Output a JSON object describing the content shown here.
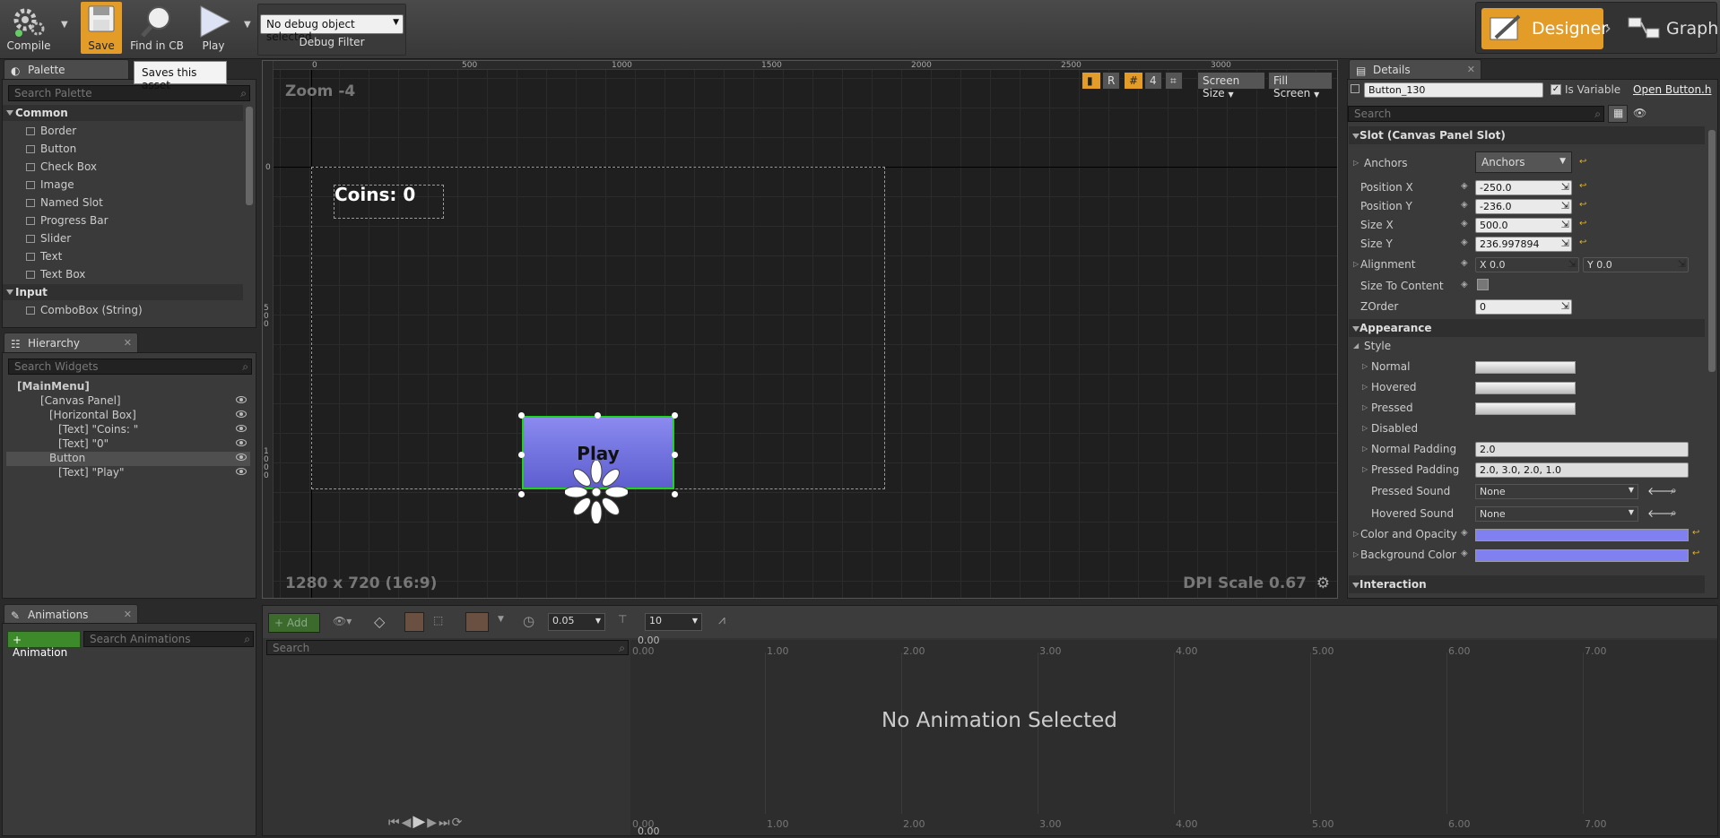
{
  "toolbar": {
    "compile": "Compile",
    "save": "Save",
    "find_in_cb": "Find in CB",
    "play": "Play",
    "debug_select": "No debug object selected",
    "debug_filter": "Debug Filter",
    "tooltip": "Saves this asset"
  },
  "mode": {
    "designer": "Designer",
    "graph": "Graph"
  },
  "palette": {
    "tab": "Palette",
    "search_placeholder": "Search Palette",
    "categories": [
      "Common",
      "Input"
    ],
    "items": [
      "Border",
      "Button",
      "Check Box",
      "Image",
      "Named Slot",
      "Progress Bar",
      "Slider",
      "Text",
      "Text Box"
    ],
    "input_items": [
      "ComboBox (String)"
    ]
  },
  "hierarchy": {
    "tab": "Hierarchy",
    "search_placeholder": "Search Widgets",
    "rows": [
      "[MainMenu]",
      "[Canvas Panel]",
      "[Horizontal Box]",
      "[Text] \"Coins: \"",
      "[Text] \"0\"",
      "Button",
      "[Text] \"Play\""
    ]
  },
  "viewport": {
    "zoom": "Zoom -4",
    "resolution": "1280 x 720 (16:9)",
    "dpi": "DPI Scale 0.67",
    "ruler_x": [
      "0",
      "500",
      "1000",
      "1500",
      "2000",
      "2500",
      "3000"
    ],
    "ruler_y": [
      "0",
      "500",
      "1000"
    ],
    "r_label": "R",
    "grid_snap": "4",
    "screen_size": "Screen Size",
    "fill_screen": "Fill Screen",
    "coins_text": "Coins: 0",
    "button_text": "Play"
  },
  "details": {
    "tab": "Details",
    "name": "Button_130",
    "is_variable": "Is Variable",
    "open": "Open Button.h",
    "search_placeholder": "Search",
    "slot_section": "Slot (Canvas Panel Slot)",
    "anchors_label": "Anchors",
    "anchors_value": "Anchors",
    "pos_x_label": "Position X",
    "pos_x": "-250.0",
    "pos_y_label": "Position Y",
    "pos_y": "-236.0",
    "size_x_label": "Size X",
    "size_x": "500.0",
    "size_y_label": "Size Y",
    "size_y": "236.997894",
    "alignment_label": "Alignment",
    "align_x": "X  0.0",
    "align_y": "Y  0.0",
    "size_to_content": "Size To Content",
    "zorder_label": "ZOrder",
    "zorder": "0",
    "appearance_section": "Appearance",
    "style": "Style",
    "normal": "Normal",
    "hovered": "Hovered",
    "pressed": "Pressed",
    "disabled": "Disabled",
    "normal_padding_label": "Normal Padding",
    "normal_padding": "2.0",
    "pressed_padding_label": "Pressed Padding",
    "pressed_padding": "2.0, 3.0, 2.0, 1.0",
    "pressed_sound_label": "Pressed Sound",
    "pressed_sound": "None",
    "hovered_sound_label": "Hovered Sound",
    "hovered_sound": "None",
    "color_opacity": "Color and Opacity",
    "bg_color": "Background Color",
    "interaction_section": "Interaction",
    "tint_color": "#8080f0"
  },
  "animations": {
    "tab": "Animations",
    "add_button": "+ Animation",
    "search_placeholder": "Search Animations"
  },
  "sequencer": {
    "add": "Add",
    "time_step": "0.05",
    "frame": "10",
    "search_placeholder": "Search",
    "no_anim": "No Animation Selected",
    "top_start": "0.00",
    "bottom_start": "0.00",
    "ticks": [
      "0.00",
      "1.00",
      "2.00",
      "3.00",
      "4.00",
      "5.00",
      "6.00",
      "7.00"
    ]
  }
}
